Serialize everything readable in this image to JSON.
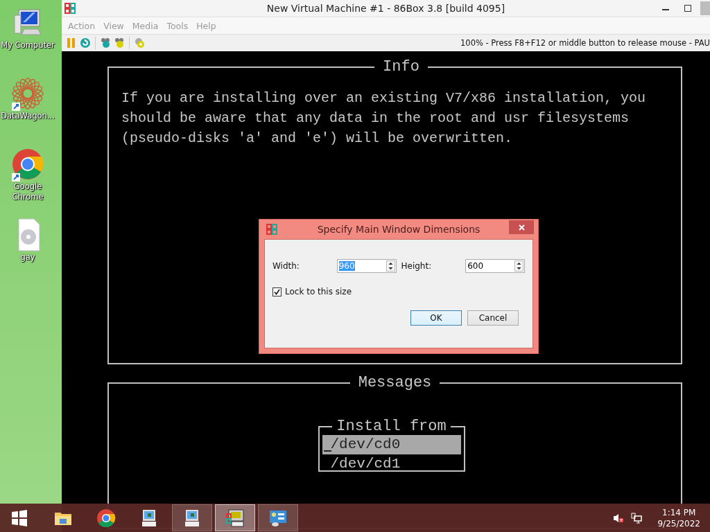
{
  "desktop_icons": [
    {
      "kind": "computer",
      "label": "My Computer",
      "shortcut": false
    },
    {
      "kind": "star",
      "label": "DataWagon...",
      "shortcut": true
    },
    {
      "kind": "chrome",
      "label": "Google Chrome",
      "shortcut": true
    },
    {
      "kind": "disc",
      "label": "gay",
      "shortcut": false
    }
  ],
  "window": {
    "title": "New Virtual Machine #1 - 86Box 3.8 [build 4095]",
    "menu": [
      {
        "label": "Action",
        "disabled": true
      },
      {
        "label": "View",
        "disabled": true
      },
      {
        "label": "Media",
        "disabled": true
      },
      {
        "label": "Tools",
        "disabled": true
      },
      {
        "label": "Help",
        "disabled": true
      }
    ],
    "toolbar": [
      {
        "kind": "pause"
      },
      {
        "kind": "reset"
      },
      {
        "kind": "sep"
      },
      {
        "kind": "cad"
      },
      {
        "kind": "cae"
      },
      {
        "kind": "sep"
      },
      {
        "kind": "settings"
      }
    ],
    "status": "100% - Press F8+F12 or middle button to release mouse - PAU"
  },
  "screen": {
    "info": {
      "title": "Info",
      "lines": [
        "If you are installing over an existing V7/x86 installation, you",
        "should be aware that any data in the root and usr filesystems",
        "(pseudo-disks 'a' and 'e') will be overwritten."
      ]
    },
    "messages": {
      "title": "Messages",
      "menu": {
        "title": "Install from",
        "items": [
          {
            "label": "/dev/cd0",
            "selected": true
          },
          {
            "label": "/dev/cd1",
            "selected": false
          }
        ]
      }
    }
  },
  "dialog": {
    "title": "Specify Main Window Dimensions",
    "fields": [
      {
        "label": "Width:",
        "value": "960",
        "highlighted": true
      },
      {
        "label": "Height:",
        "value": "600",
        "highlighted": false
      }
    ],
    "checkbox": {
      "label": "Lock to this size",
      "checked": true
    },
    "buttons": [
      {
        "label": "OK",
        "default": true
      },
      {
        "label": "Cancel",
        "default": false
      }
    ]
  },
  "taskbar": {
    "items": [
      {
        "kind": "start",
        "running": false,
        "selected": false
      },
      {
        "kind": "folder",
        "running": false,
        "selected": false
      },
      {
        "kind": "chrome",
        "running": false,
        "selected": false
      },
      {
        "kind": "monitor",
        "running": false,
        "selected": false
      },
      {
        "kind": "monitor",
        "running": true,
        "selected": false
      },
      {
        "kind": "box",
        "running": true,
        "selected": true
      },
      {
        "kind": "panel",
        "running": true,
        "selected": false
      }
    ],
    "clock": {
      "time": "1:14 PM",
      "date": "9/25/2022"
    }
  }
}
